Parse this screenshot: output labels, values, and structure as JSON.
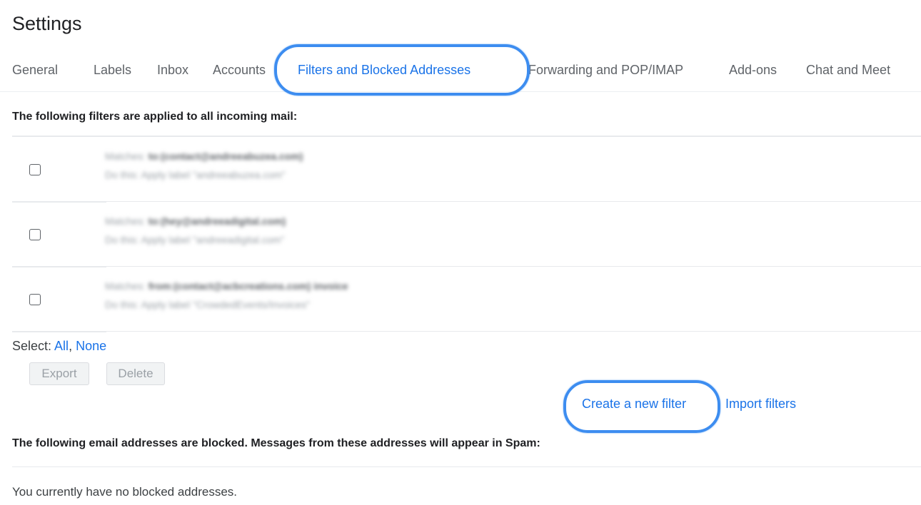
{
  "page": {
    "title": "Settings"
  },
  "tabs": [
    {
      "label": "General",
      "active": false
    },
    {
      "label": "Labels",
      "active": false
    },
    {
      "label": "Inbox",
      "active": false
    },
    {
      "label": "Accounts",
      "active": false
    },
    {
      "label": "Filters and Blocked Addresses",
      "active": true
    },
    {
      "label": "Forwarding and POP/IMAP",
      "active": false
    },
    {
      "label": "Add-ons",
      "active": false
    },
    {
      "label": "Chat and Meet",
      "active": false
    }
  ],
  "filters": {
    "heading": "The following filters are applied to all incoming mail:",
    "items": [
      {
        "matches_prefix": "Matches:",
        "matches": "to:(contact@andreeabuzea.com)",
        "action": "Do this: Apply label \"andreeabuzea.com\""
      },
      {
        "matches_prefix": "Matches:",
        "matches": "to:(hey@andreeadigital.com)",
        "action": "Do this: Apply label \"andreeadigital.com\""
      },
      {
        "matches_prefix": "Matches:",
        "matches": "from:(contact@acbcreations.com) invoice",
        "action": "Do this: Apply label \"CrowdedEvents/Invoices\""
      }
    ],
    "select_label": "Select:",
    "select_all": "All",
    "select_separator": ",",
    "select_none": "None",
    "export_label": "Export",
    "delete_label": "Delete",
    "create_label": "Create a new filter",
    "import_label": "Import filters"
  },
  "blocked": {
    "heading": "The following email addresses are blocked. Messages from these addresses will appear in Spam:",
    "empty_text": "You currently have no blocked addresses."
  },
  "colors": {
    "accent": "#1a73e8",
    "highlight_ring": "#3d8df0"
  }
}
